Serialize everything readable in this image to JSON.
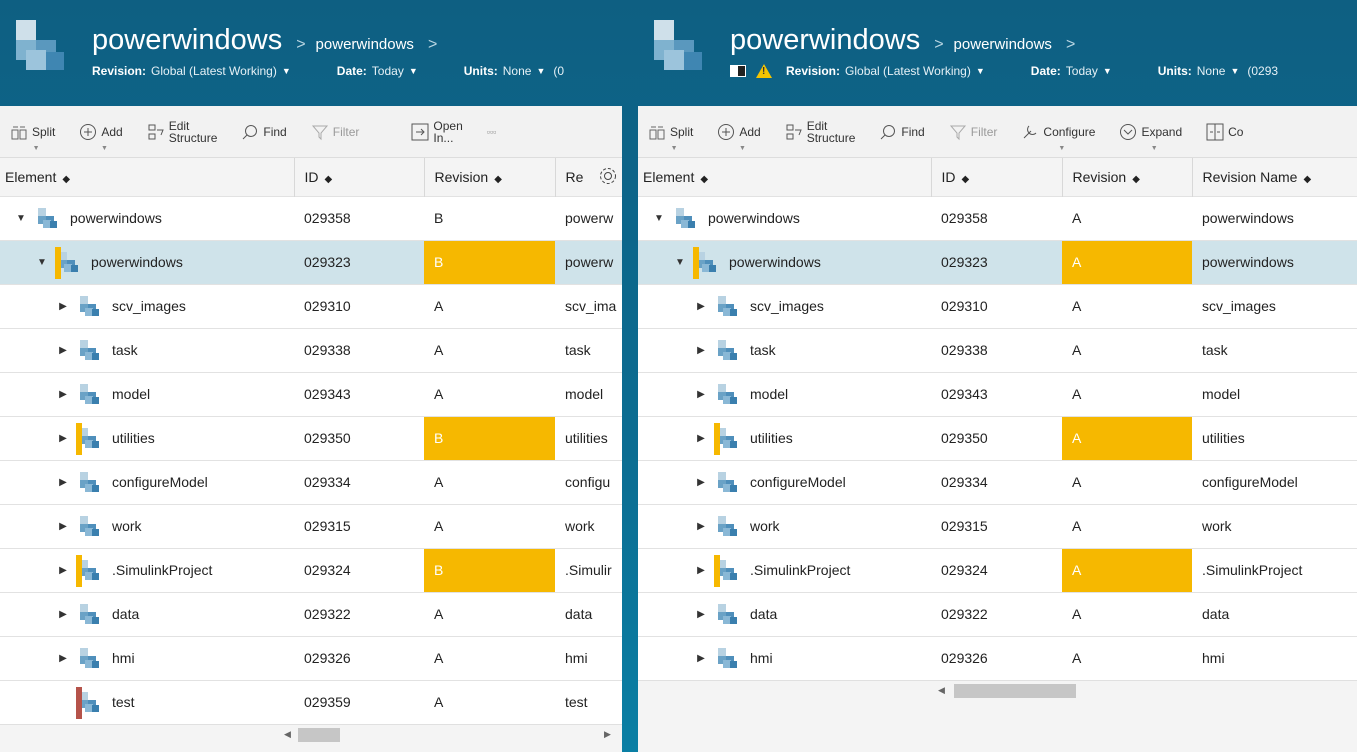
{
  "left": {
    "title": "powerwindows",
    "breadcrumb": "powerwindows",
    "meta": {
      "revision_label": "Revision:",
      "revision_value": "Global (Latest Working)",
      "date_label": "Date:",
      "date_value": "Today",
      "units_label": "Units:",
      "units_value": "None",
      "units_extra": "(0"
    },
    "toolbar": {
      "split": "Split",
      "add": "Add",
      "edit1": "Edit",
      "edit2": "Structure",
      "find": "Find",
      "filter": "Filter",
      "open1": "Open",
      "open2": "In...",
      "more": "▫▫▫"
    },
    "columns": [
      "Element",
      "ID",
      "Revision",
      "Re"
    ],
    "rows": [
      {
        "name": "powerwindows",
        "id": "029358",
        "rev": "B",
        "revname": "powerw"
      },
      {
        "name": "powerwindows",
        "id": "029323",
        "rev": "B",
        "revname": "powerw"
      },
      {
        "name": "scv_images",
        "id": "029310",
        "rev": "A",
        "revname": "scv_ima"
      },
      {
        "name": "task",
        "id": "029338",
        "rev": "A",
        "revname": "task"
      },
      {
        "name": "model",
        "id": "029343",
        "rev": "A",
        "revname": "model"
      },
      {
        "name": "utilities",
        "id": "029350",
        "rev": "B",
        "revname": "utilities"
      },
      {
        "name": "configureModel",
        "id": "029334",
        "rev": "A",
        "revname": "configu"
      },
      {
        "name": "work",
        "id": "029315",
        "rev": "A",
        "revname": "work"
      },
      {
        "name": ".SimulinkProject",
        "id": "029324",
        "rev": "B",
        "revname": ".Simulir"
      },
      {
        "name": "data",
        "id": "029322",
        "rev": "A",
        "revname": "data"
      },
      {
        "name": "hmi",
        "id": "029326",
        "rev": "A",
        "revname": "hmi"
      },
      {
        "name": "test",
        "id": "029359",
        "rev": "A",
        "revname": "test"
      }
    ]
  },
  "right": {
    "title": "powerwindows",
    "breadcrumb": "powerwindows",
    "meta": {
      "revision_label": "Revision:",
      "revision_value": "Global (Latest Working)",
      "date_label": "Date:",
      "date_value": "Today",
      "units_label": "Units:",
      "units_value": "None",
      "units_extra": "(0293"
    },
    "toolbar": {
      "split": "Split",
      "add": "Add",
      "edit1": "Edit",
      "edit2": "Structure",
      "find": "Find",
      "filter": "Filter",
      "configure": "Configure",
      "expand": "Expand",
      "co": "Co"
    },
    "columns": [
      "Element",
      "ID",
      "Revision",
      "Revision Name"
    ],
    "rows": [
      {
        "name": "powerwindows",
        "id": "029358",
        "rev": "A",
        "revname": "powerwindows"
      },
      {
        "name": "powerwindows",
        "id": "029323",
        "rev": "A",
        "revname": "powerwindows"
      },
      {
        "name": "scv_images",
        "id": "029310",
        "rev": "A",
        "revname": "scv_images"
      },
      {
        "name": "task",
        "id": "029338",
        "rev": "A",
        "revname": "task"
      },
      {
        "name": "model",
        "id": "029343",
        "rev": "A",
        "revname": "model"
      },
      {
        "name": "utilities",
        "id": "029350",
        "rev": "A",
        "revname": "utilities"
      },
      {
        "name": "configureModel",
        "id": "029334",
        "rev": "A",
        "revname": "configureModel"
      },
      {
        "name": "work",
        "id": "029315",
        "rev": "A",
        "revname": "work"
      },
      {
        "name": ".SimulinkProject",
        "id": "029324",
        "rev": "A",
        "revname": ".SimulinkProject"
      },
      {
        "name": "data",
        "id": "029322",
        "rev": "A",
        "revname": "data"
      },
      {
        "name": "hmi",
        "id": "029326",
        "rev": "A",
        "revname": "hmi"
      }
    ]
  },
  "colors": {
    "header_bg": "#0e6489",
    "changed": "#f6b800",
    "selected_row": "#cfe3ea",
    "new_marker": "#b5534a"
  }
}
